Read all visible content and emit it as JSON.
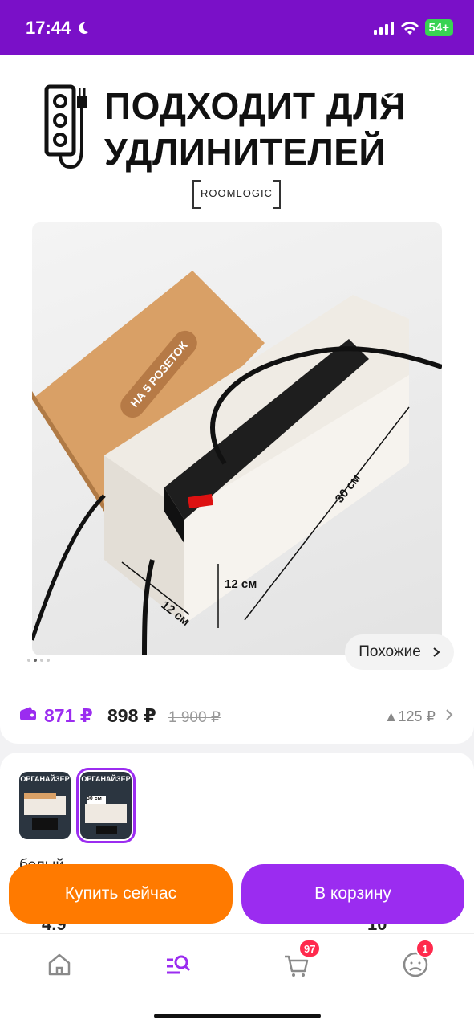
{
  "status_bar": {
    "time": "17:44",
    "battery": "54+"
  },
  "hero": {
    "title_line1": "ПОДХОДИТ ДЛЯ",
    "title_line2": "УДЛИНИТЕЛЕЙ",
    "brand": "ROOMLOGIC",
    "photo_labels": {
      "badge": "НА 5 РОЗЕТОК",
      "length": "30 см",
      "height": "12 см",
      "width": "12 см"
    },
    "similar_label": "Похожие",
    "carousel": {
      "total": 5,
      "active": 2
    }
  },
  "price": {
    "card_price": "871 ₽",
    "price": "898 ₽",
    "old_price": "1 900 ₽",
    "bonus": "▲125 ₽"
  },
  "variants": {
    "items": [
      {
        "caption": "ОРГАНАЙЗЕР",
        "selected": false
      },
      {
        "caption": "ОРГАНАЙЗЕР",
        "selected": true,
        "size": "30 см"
      }
    ],
    "color_label": "белый"
  },
  "actions": {
    "buy_now": "Купить сейчас",
    "add_to_cart": "В корзину"
  },
  "peek": {
    "rating": "4.9",
    "questions": "10"
  },
  "tabbar": {
    "cart_badge": "97",
    "profile_badge": "1"
  },
  "colors": {
    "brand_purple": "#9b2cf0",
    "status_purple": "#7a10c8",
    "buy_orange": "#ff7a00",
    "badge_red": "#ff2a4d"
  }
}
